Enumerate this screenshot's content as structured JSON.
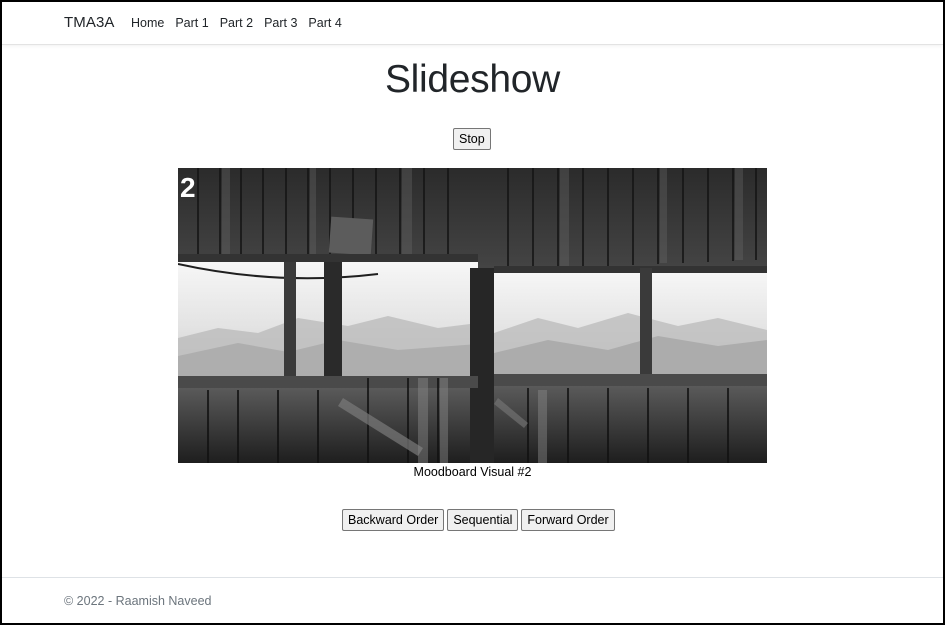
{
  "navbar": {
    "brand": "TMA3A",
    "links": [
      {
        "label": "Home"
      },
      {
        "label": "Part 1"
      },
      {
        "label": "Part 2"
      },
      {
        "label": "Part 3"
      },
      {
        "label": "Part 4"
      }
    ]
  },
  "main": {
    "title": "Slideshow",
    "stop_label": "Stop",
    "slide": {
      "number_overlay": "2",
      "caption": "Moodboard Visual #2"
    },
    "order_buttons": {
      "backward": "Backward Order",
      "sequential": "Sequential",
      "forward": "Forward Order"
    }
  },
  "footer": {
    "text": "© 2022 - Raamish Naveed"
  }
}
